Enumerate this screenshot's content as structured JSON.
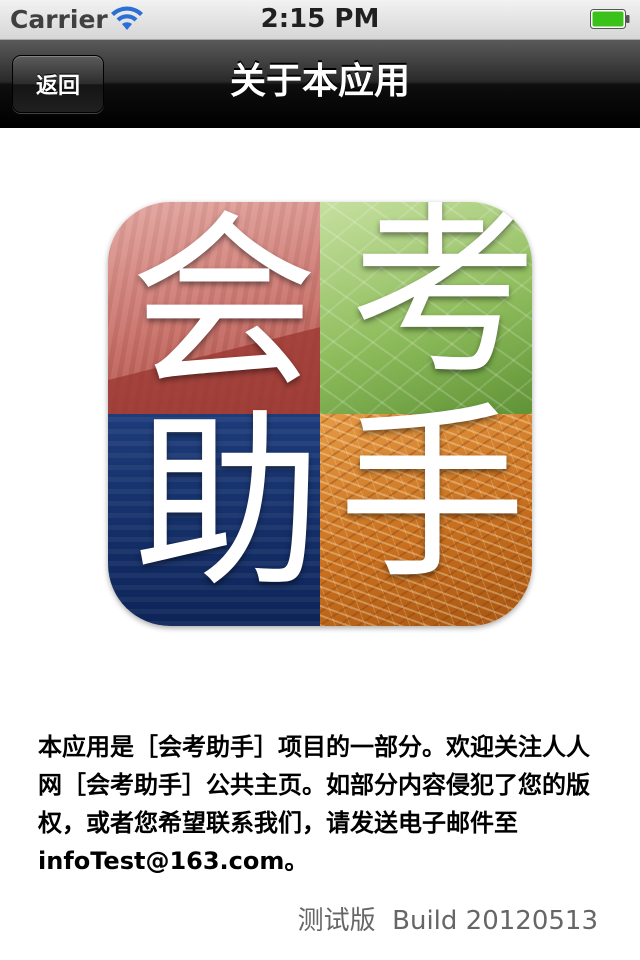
{
  "status_bar": {
    "carrier": "Carrier",
    "time": "2:15 PM",
    "battery_color": "#3ac21a"
  },
  "nav_bar": {
    "back_label": "返回",
    "title": "关于本应用"
  },
  "app_icon": {
    "characters": [
      "会",
      "考",
      "助",
      "手"
    ],
    "quadrant_colors": [
      "#c9726a",
      "#8fbd5d",
      "#15306a",
      "#c8701f"
    ]
  },
  "description": "本应用是［会考助手］项目的一部分。欢迎关注人人网［会考助手］公共主页。如部分内容侵犯了您的版权，或者您希望联系我们，请发送电子邮件至infoTest@163.com。",
  "version": {
    "label": "测试版",
    "build": "Build 20120513"
  },
  "icons": [
    "wifi-icon",
    "battery-icon"
  ]
}
